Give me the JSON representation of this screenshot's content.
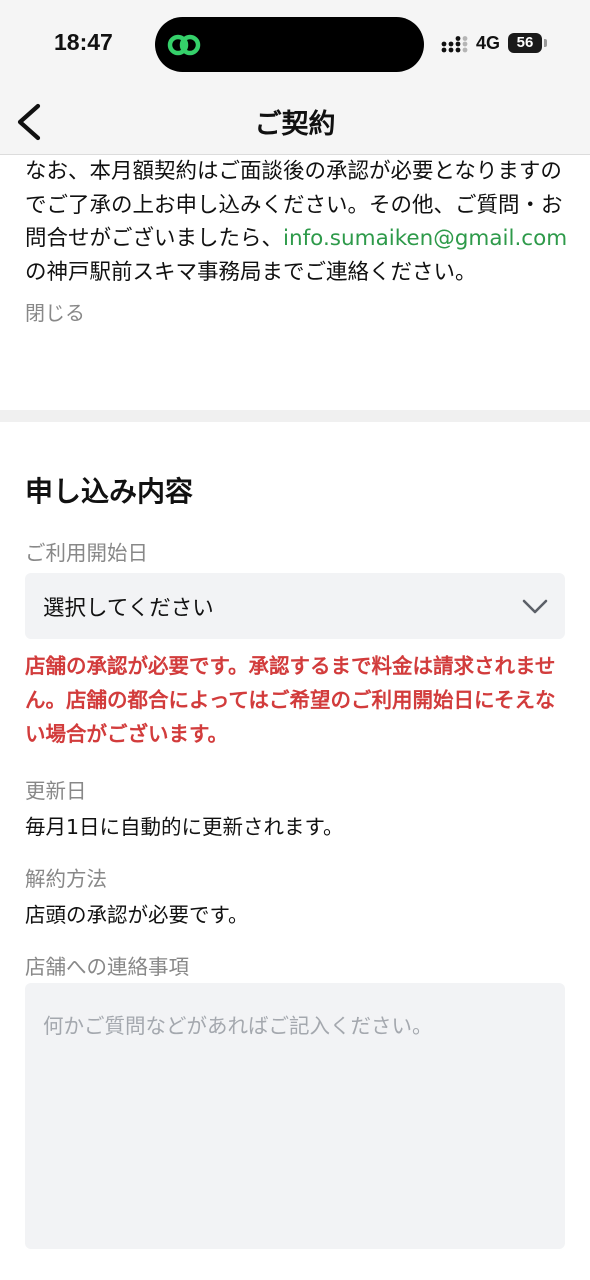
{
  "status_bar": {
    "time": "18:47",
    "network": "4G",
    "battery": "56",
    "accent_color": "#35d06a"
  },
  "nav": {
    "title": "ご契約",
    "back_icon": "chevron-left-icon"
  },
  "notice": {
    "text_before": "なお、本月額契約はご面談後の承認が必要となりますのでご了承の上お申し込みください。その他、ご質問・お問合せがございましたら、",
    "email": "info.sumaiken@gmail.com",
    "text_after": "　の神戸駅前スキマ事務局までご連絡ください。",
    "close_label": "閉じる",
    "link_color": "#2e9a4a"
  },
  "application": {
    "section_title": "申し込み内容",
    "start_date": {
      "label": "ご利用開始日",
      "selected": "選択してください"
    },
    "warning": "店舗の承認が必要です。承認するまで料金は請求されません。店舗の都合によってはご希望のご利用開始日にそえない場合がございます。",
    "warning_color": "#d23c3c",
    "renewal": {
      "label": "更新日",
      "value": "毎月1日に自動的に更新されます。"
    },
    "cancellation": {
      "label": "解約方法",
      "value": "店頭の承認が必要です。"
    },
    "message": {
      "label": "店舗への連絡事項",
      "placeholder": "何かご質問などがあればご記入ください。",
      "value": ""
    }
  }
}
